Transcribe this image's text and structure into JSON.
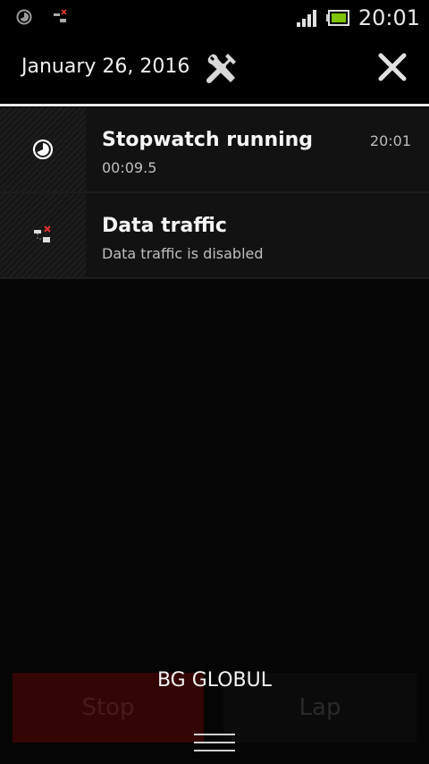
{
  "status_bar": {
    "time": "20:01",
    "left_icons": [
      "stopwatch-icon",
      "data-traffic-disabled-icon"
    ],
    "right_icons": [
      "signal-icon",
      "battery-icon"
    ]
  },
  "header": {
    "date": "January 26, 2016",
    "settings_icon": "tools-icon",
    "close_icon": "close-icon"
  },
  "notifications": [
    {
      "icon": "stopwatch-icon",
      "title": "Stopwatch running",
      "subtitle": "00:09.5",
      "time": "20:01"
    },
    {
      "icon": "data-traffic-disabled-icon",
      "title": "Data traffic",
      "subtitle": "Data traffic is disabled"
    }
  ],
  "background_app": {
    "stop_label": "Stop",
    "lap_label": "Lap"
  },
  "carrier": "BG GLOBUL",
  "colors": {
    "accent_red": "#c0392b",
    "battery_green": "#7ec400"
  }
}
